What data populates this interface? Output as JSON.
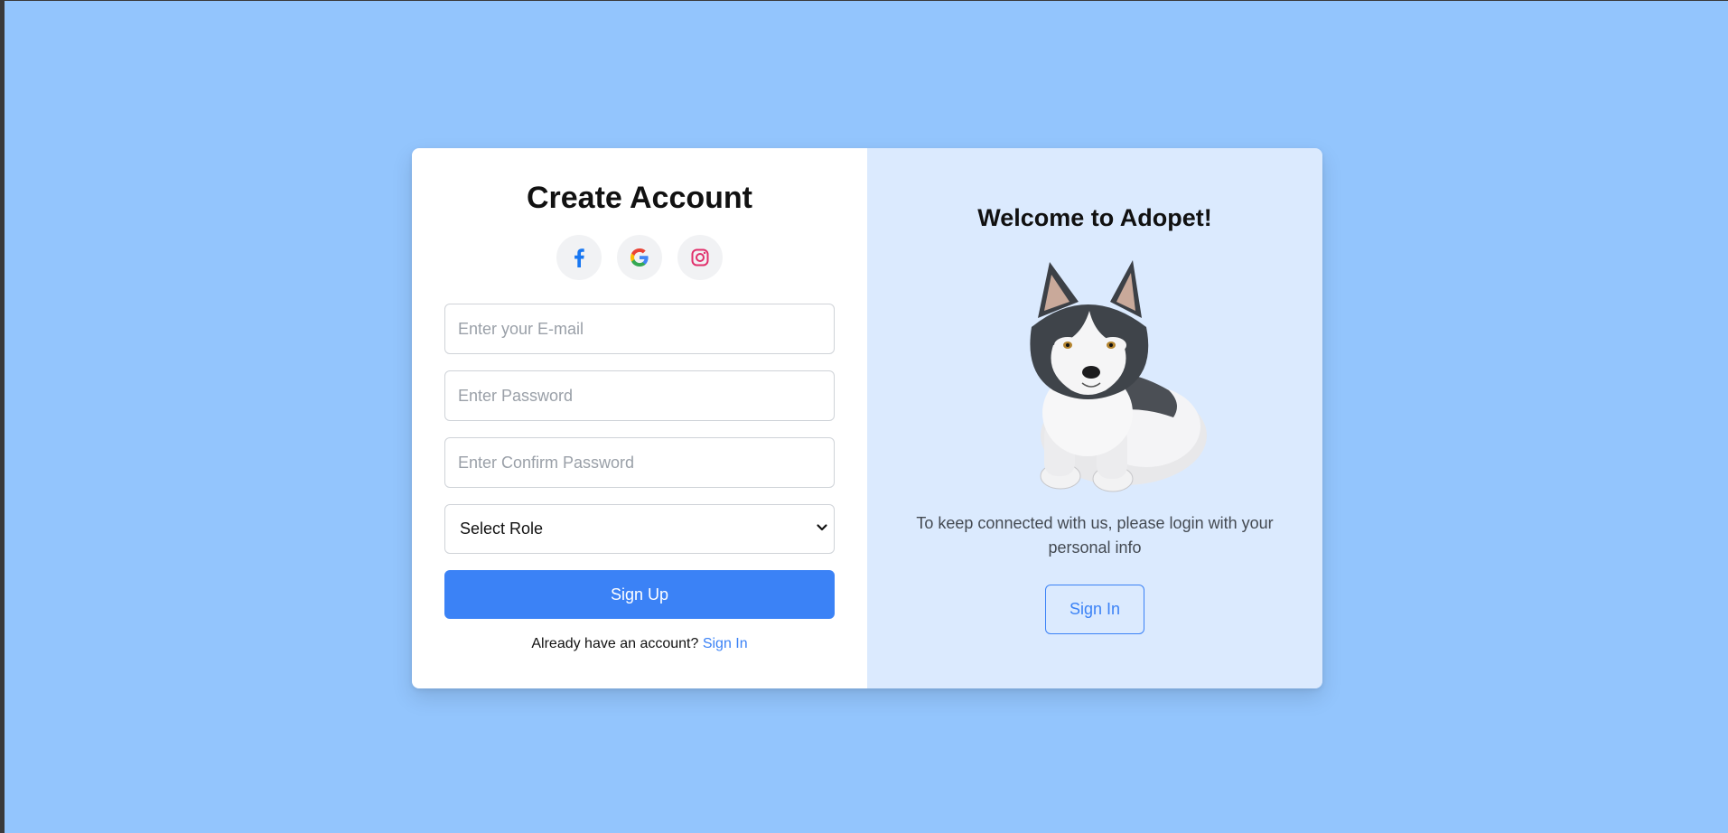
{
  "signup": {
    "title": "Create Account",
    "socials": [
      {
        "icon": "facebook-icon",
        "color": "#1877f2"
      },
      {
        "icon": "google-icon",
        "color": "#4285f4"
      },
      {
        "icon": "instagram-icon",
        "color": "#e1306c"
      }
    ],
    "email": {
      "placeholder": "Enter your E-mail",
      "value": ""
    },
    "password": {
      "placeholder": "Enter Password",
      "value": ""
    },
    "confirm_password": {
      "placeholder": "Enter Confirm Password",
      "value": ""
    },
    "role_select": {
      "selected": "Select Role"
    },
    "signup_button": "Sign Up",
    "already_text": "Already have an account?",
    "signin_link": "Sign In"
  },
  "welcome": {
    "title": "Welcome to Adopet!",
    "info": "To keep connected with us, please login with your personal info",
    "signin_button": "Sign In"
  },
  "colors": {
    "background": "#93c5fd",
    "panel": "#dbeafe",
    "accent": "#3b82f6"
  }
}
